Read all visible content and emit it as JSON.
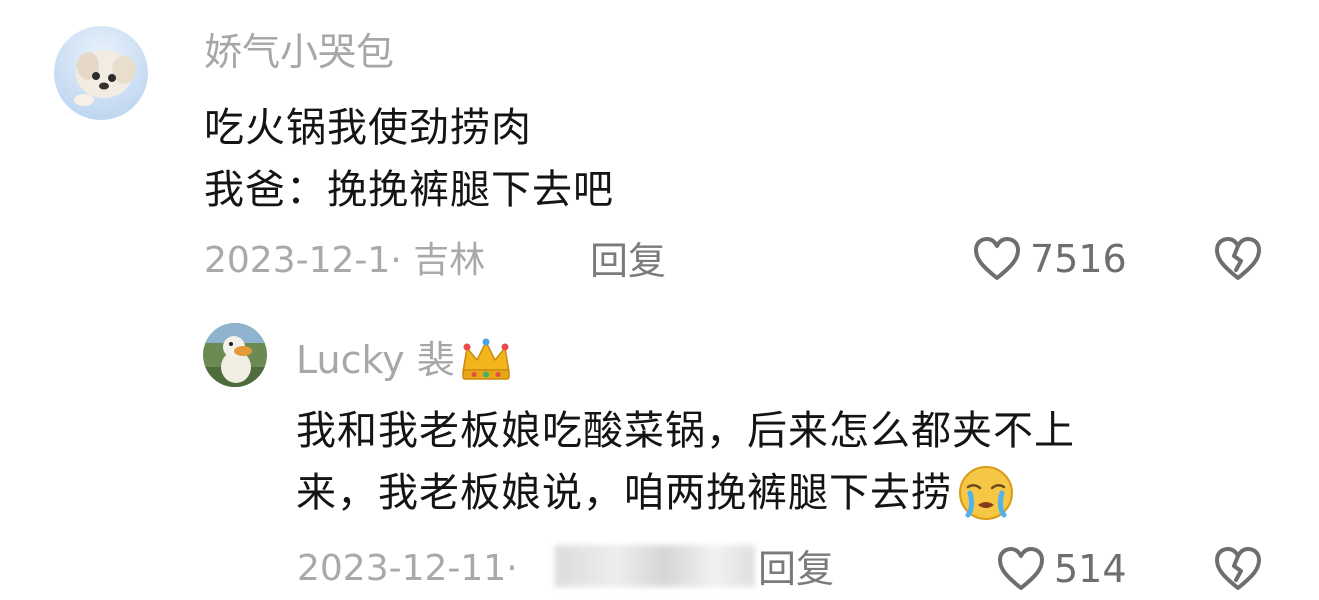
{
  "comments": [
    {
      "username": "娇气小哭包",
      "lines": [
        "吃火锅我使劲捞肉",
        "我爸：挽挽裤腿下去吧"
      ],
      "meta": "2023-12-1· 吉林",
      "reply_label": "回复",
      "likes": "7516"
    }
  ],
  "reply": {
    "username": "Lucky 裴",
    "badge_icon": "crown-icon",
    "lines": [
      "我和我老板娘吃酸菜锅，后来怎么都夹不上",
      "来，我老板娘说，咱两挽裤腿下去捞"
    ],
    "emoji_icon": "crying-face-icon",
    "meta": "2023-12-11·",
    "reply_label": "回复",
    "likes": "514"
  },
  "colors": {
    "meta_gray": "#a9a9a9",
    "text": "#141414",
    "icon_gray": "#6e6e6e"
  }
}
